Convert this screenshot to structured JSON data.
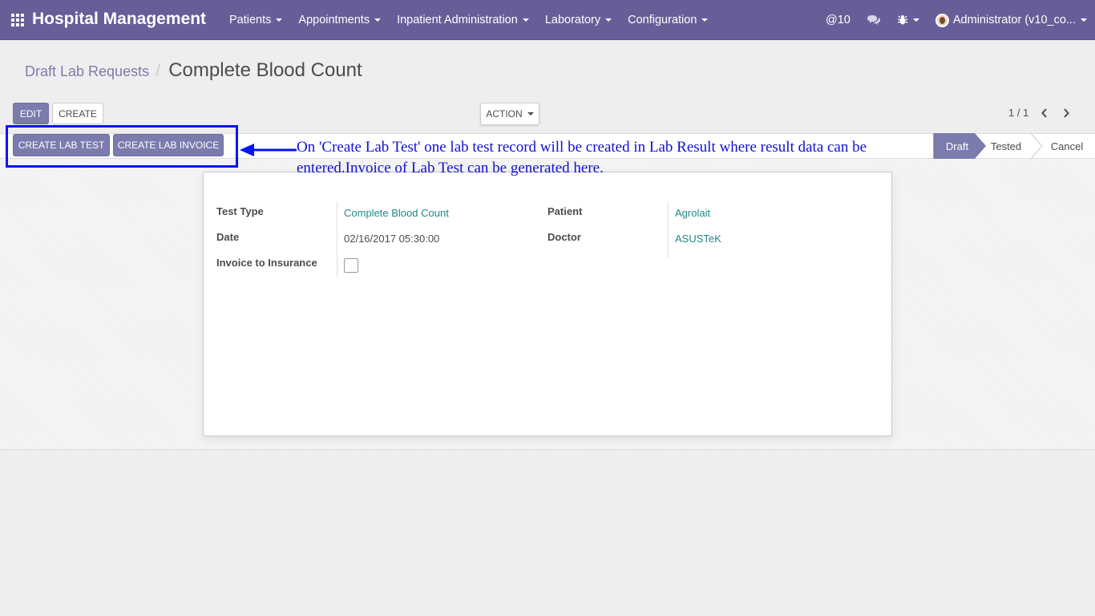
{
  "navbar": {
    "brand": "Hospital Management",
    "menu": [
      {
        "label": "Patients"
      },
      {
        "label": "Appointments"
      },
      {
        "label": "Inpatient Administration"
      },
      {
        "label": "Laboratory"
      },
      {
        "label": "Configuration"
      }
    ],
    "mentions": "@10",
    "user": "Administrator (v10_co..."
  },
  "breadcrumb": {
    "parent": "Draft Lab Requests",
    "current": "Complete Blood Count"
  },
  "buttons": {
    "edit": "EDIT",
    "create": "CREATE",
    "action": "ACTION",
    "create_lab_test": "CREATE LAB TEST",
    "create_lab_invoice": "CREATE LAB INVOICE"
  },
  "pager": {
    "value": "1 / 1"
  },
  "status": {
    "stages": [
      "Draft",
      "Tested",
      "Cancel"
    ],
    "current": "Draft"
  },
  "annotation": "On 'Create Lab Test' one lab test record will be created in Lab Result where result data can be entered.Invoice of Lab Test can be generated here.",
  "form": {
    "test_type_label": "Test Type",
    "test_type": "Complete Blood Count",
    "date_label": "Date",
    "date": "02/16/2017 05:30:00",
    "invoice_label": "Invoice to Insurance",
    "patient_label": "Patient",
    "patient": "Agrolait",
    "doctor_label": "Doctor",
    "doctor": "ASUSTeK"
  },
  "colors": {
    "navbar": "#675e98",
    "primary": "#7c7bad",
    "link": "#21888a",
    "highlight": "#0015ff"
  }
}
